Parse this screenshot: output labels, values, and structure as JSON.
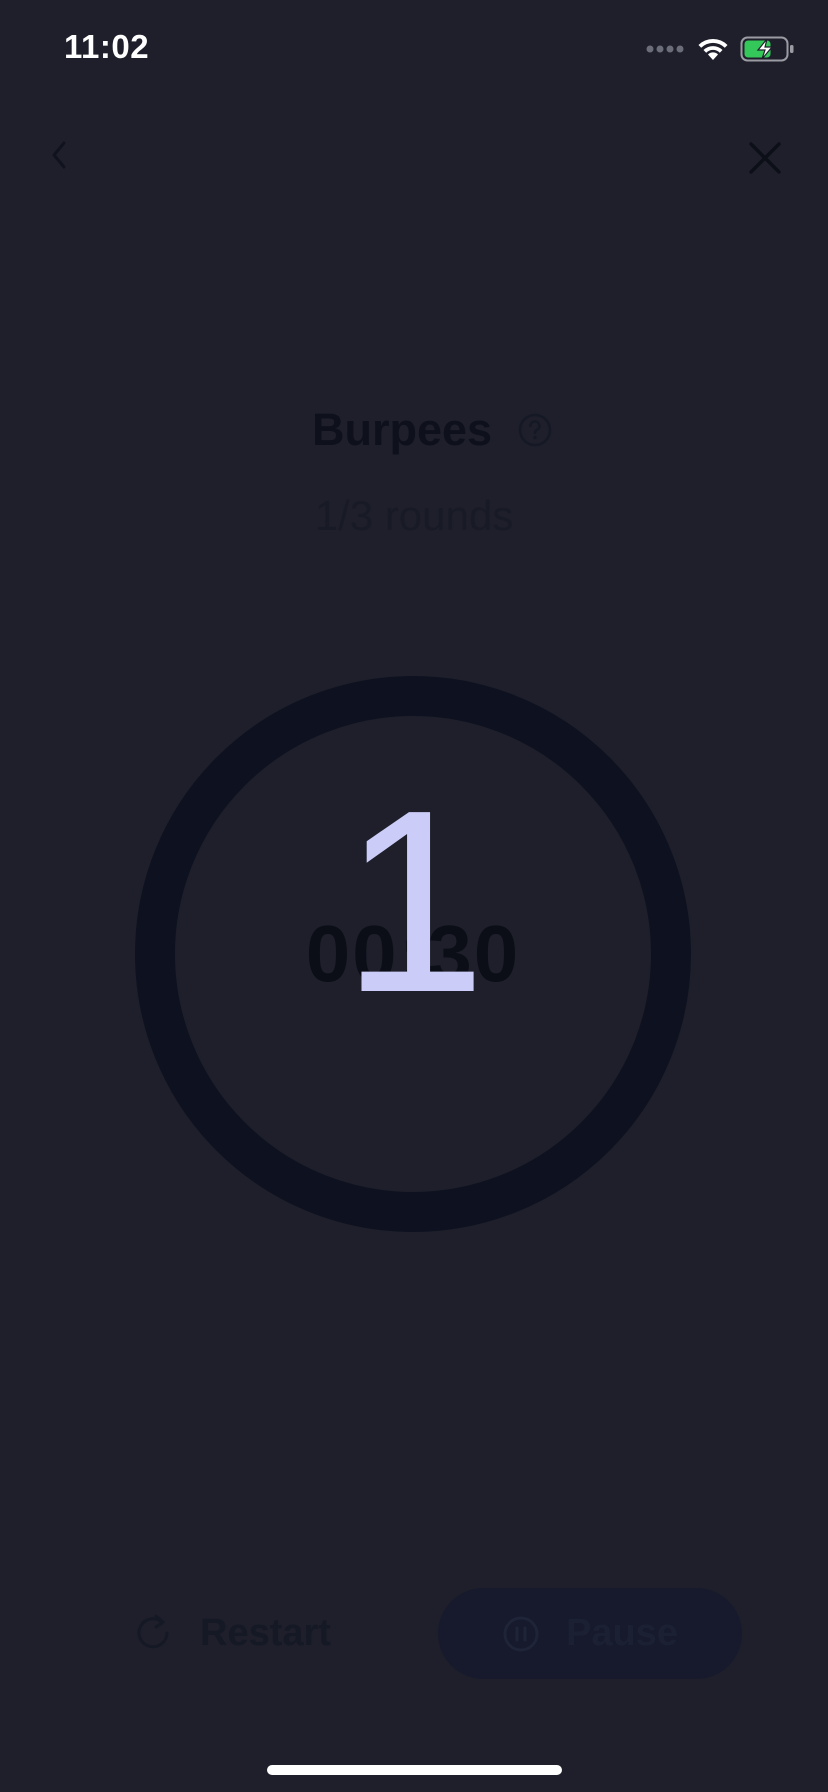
{
  "status_bar": {
    "time": "11:02",
    "icons": [
      "signal-dots-icon",
      "wifi-icon",
      "battery-charging-icon"
    ],
    "battery_color": "#34c759"
  },
  "nav": {
    "back_icon": "chevron-left-icon",
    "close_icon": "close-icon"
  },
  "workout": {
    "title": "Burpees",
    "help_icon": "question-circle-icon",
    "rounds": "1/3 rounds",
    "timer": "00:30",
    "countdown": "1"
  },
  "controls": {
    "restart_label": "Restart",
    "restart_icon": "restart-icon",
    "pause_label": "Pause",
    "pause_icon": "pause-circle-icon"
  },
  "colors": {
    "background": "#1e1f2b",
    "ring": "#0e1220",
    "countdown": "#cbcdf8",
    "pause_button": "#161a2c"
  }
}
